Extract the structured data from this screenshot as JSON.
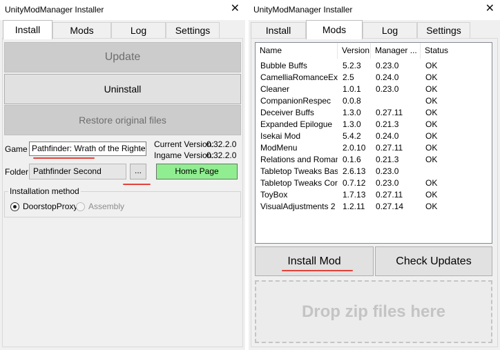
{
  "left_window": {
    "title": "UnityModManager Installer",
    "close_glyph": "✕",
    "tabs": [
      {
        "label": "Install",
        "active": true
      },
      {
        "label": "Mods",
        "active": false
      },
      {
        "label": "Log",
        "active": false
      },
      {
        "label": "Settings",
        "active": false
      }
    ],
    "install": {
      "update_label": "Update",
      "uninstall_label": "Uninstall",
      "restore_label": "Restore original files",
      "game_label": "Game",
      "game_value": "Pathfinder: Wrath of the Righte",
      "current_version_label": "Current Version:",
      "current_version_value": "0.32.2.0",
      "ingame_version_label": "Ingame Version:",
      "ingame_version_value": "0.32.2.0",
      "folder_label": "Folder",
      "folder_value": "Pathfinder Second",
      "browse_label": "...",
      "homepage_label": "Home Page",
      "installation_method_label": "Installation method",
      "methods": [
        {
          "label": "DoorstopProxy",
          "checked": true,
          "enabled": true
        },
        {
          "label": "Assembly",
          "checked": false,
          "enabled": false
        }
      ]
    }
  },
  "right_window": {
    "title": "UnityModManager Installer",
    "close_glyph": "✕",
    "tabs": [
      {
        "label": "Install",
        "active": false
      },
      {
        "label": "Mods",
        "active": true
      },
      {
        "label": "Log",
        "active": false
      },
      {
        "label": "Settings",
        "active": false
      }
    ],
    "mods": {
      "columns": [
        "Name",
        "Version",
        "Manager ...",
        "Status"
      ],
      "rows": [
        [
          "Bubble Buffs",
          "5.2.3",
          "0.23.0",
          "OK"
        ],
        [
          "CamelliaRomanceExp...",
          "2.5",
          "0.24.0",
          "OK"
        ],
        [
          "Cleaner",
          "1.0.1",
          "0.23.0",
          "OK"
        ],
        [
          "CompanionRespec",
          "0.0.8",
          "",
          "OK"
        ],
        [
          "Deceiver Buffs",
          "1.3.0",
          "0.27.11",
          "OK"
        ],
        [
          "Expanded Epilogue",
          "1.3.0",
          "0.21.3",
          "OK"
        ],
        [
          "Isekai Mod",
          "5.4.2",
          "0.24.0",
          "OK"
        ],
        [
          "ModMenu",
          "2.0.10",
          "0.27.11",
          "OK"
        ],
        [
          "Relations and Roman...",
          "0.1.6",
          "0.21.3",
          "OK"
        ],
        [
          "Tabletop Tweaks Base",
          "2.6.13",
          "0.23.0",
          ""
        ],
        [
          "Tabletop Tweaks Core",
          "0.7.12",
          "0.23.0",
          "OK"
        ],
        [
          "ToyBox",
          "1.7.13",
          "0.27.11",
          "OK"
        ],
        [
          "VisualAdjustments 2",
          "1.2.11",
          "0.27.14",
          "OK"
        ]
      ],
      "install_mod_label": "Install Mod",
      "check_updates_label": "Check Updates",
      "drop_zone_label": "Drop zip files here"
    }
  },
  "colors": {
    "window_bg": "#f0f0f0",
    "home_page_button": "#90ee90",
    "annotation_underline": "#e3413a",
    "disabled_button": "#cccccc"
  }
}
